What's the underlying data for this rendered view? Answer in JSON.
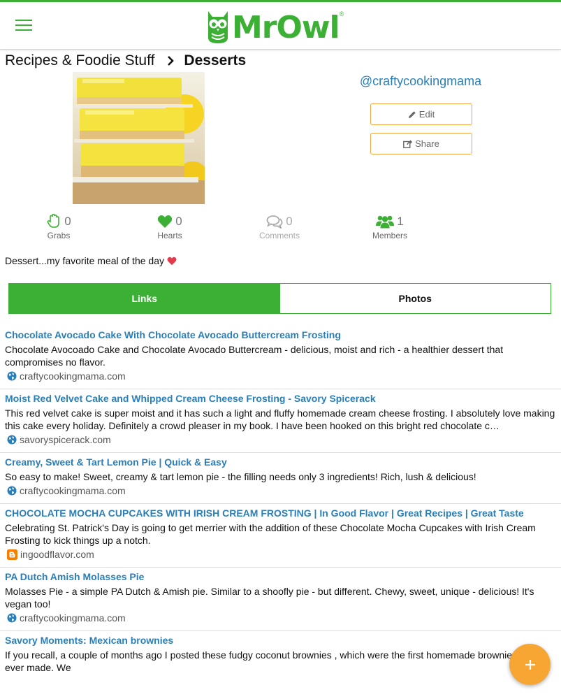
{
  "header": {
    "logo_text": "MrOwl",
    "logo_mark": "®",
    "menu_icon": "hamburger-menu-icon",
    "accent": "#3cb034"
  },
  "breadcrumb": {
    "parent": "Recipes & Foodie Stuff",
    "current": "Desserts"
  },
  "board": {
    "image": "lemon-bars-photo",
    "owner": "@craftycookingmama",
    "edit_label": "Edit",
    "share_label": "Share",
    "button_border": "#f0a442"
  },
  "stats": {
    "grabs": {
      "count": "0",
      "label": "Grabs",
      "icon": "hand-grab-icon"
    },
    "hearts": {
      "count": "0",
      "label": "Hearts",
      "icon": "heart-icon"
    },
    "comments": {
      "count": "0",
      "label": "Comments",
      "icon": "comments-icon"
    },
    "members": {
      "count": "1",
      "label": "Members",
      "icon": "users-icon"
    }
  },
  "description": "Dessert...my favorite meal of the day",
  "tabs": [
    {
      "label": "Links",
      "active": true
    },
    {
      "label": "Photos",
      "active": false
    }
  ],
  "links": [
    {
      "title": "Chocolate Avocado Cake With Chocolate Avocado Buttercream Frosting",
      "description": "Chocolate Avocoado Cake and Chocolate Avocado Buttercream - delicious, moist and rich - a healthier dessert that compromises no flavor.",
      "domain": "craftycookingmama.com",
      "icon": "globe-icon"
    },
    {
      "title": "Moist Red Velvet Cake and Whipped Cream Cheese Frosting  - Savory Spicerack",
      "description": "This red velvet cake is super moist and it has such a light and fluffy homemade cream cheese frosting.  I absolutely love making this cake every holiday.  Definitely a crowd pleaser in my book. I have been hooked on this bright red chocolate c…",
      "domain": "savoryspicerack.com",
      "icon": "globe-icon"
    },
    {
      "title": "Creamy, Sweet & Tart Lemon Pie | Quick & Easy",
      "description": "So easy to make! Sweet, creamy & tart lemon pie - the filling needs only 3 ingredients! Rich, lush & delicious!",
      "domain": "craftycookingmama.com",
      "icon": "globe-icon"
    },
    {
      "title": "CHOCOLATE MOCHA CUPCAKES WITH IRISH CREAM FROSTING | In Good Flavor | Great Recipes | Great Taste",
      "description": "Celebrating St. Patrick's Day is going to get merrier with the addition of these Chocolate Mocha Cupcakes with Irish Cream Frosting to kick things up a notch.",
      "domain": "ingoodflavor.com",
      "icon": "blogger-icon"
    },
    {
      "title": "PA Dutch Amish Molasses Pie",
      "description": "Molasses Pie - a simple PA Dutch & Amish pie. Similar to a shoofly pie - but different. Chewy, sweet, unique - delicious! It's vegan too!",
      "domain": "craftycookingmama.com",
      "icon": "globe-icon"
    },
    {
      "title": "Savory Moments: Mexican brownies",
      "description": "If you recall, a couple of months ago I posted these fudgy coconut brownies , which were the first homemade brownies I had ever  made. We",
      "domain": "",
      "icon": "globe-icon"
    }
  ],
  "fab": {
    "icon": "plus-icon",
    "color": "#f7a533"
  }
}
